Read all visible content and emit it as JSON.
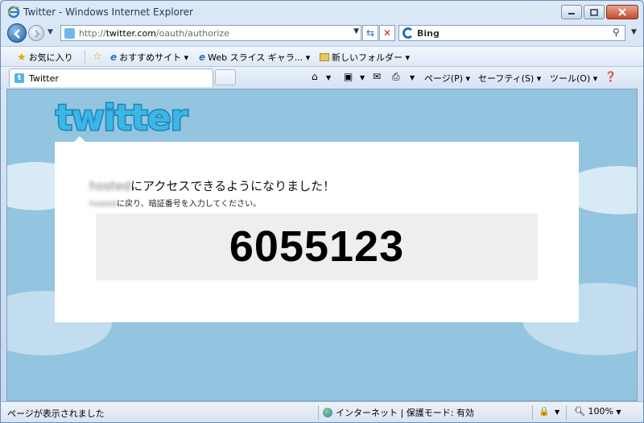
{
  "window": {
    "title": "Twitter - Windows Internet Explorer"
  },
  "address_bar": {
    "url_prefix": "http://",
    "url_host": "twitter.com",
    "url_path": "/oauth/authorize"
  },
  "search": {
    "provider": "Bing"
  },
  "favorites_bar": {
    "favorites_label": "お気に入り",
    "items": [
      "おすすめサイト ▾",
      "Web スライス ギャラ... ▾",
      "新しいフォルダー ▾"
    ]
  },
  "tabs": [
    {
      "label": "Twitter"
    }
  ],
  "command_bar": {
    "page": "ページ(P) ▾",
    "safety": "セーフティ(S) ▾",
    "tools": "ツール(O) ▾"
  },
  "page": {
    "logo_text": "twitter",
    "app_name_redacted": "hosted",
    "access_granted_suffix": "にアクセスできるようになりました！",
    "hint_app_redacted": "hosted",
    "hint_suffix": "に戻り、暗証番号を入力してください。",
    "pin": "6055123"
  },
  "status_bar": {
    "message": "ページが表示されました",
    "zone": "インターネット | 保護モード: 有効",
    "zoom": "100%"
  },
  "icons": [
    "ie-icon",
    "minimize-icon",
    "maximize-icon",
    "close-icon",
    "back-icon",
    "forward-icon",
    "refresh-icon",
    "stop-icon",
    "bing-icon",
    "search-icon",
    "favorites-star-icon",
    "home-icon",
    "feeds-icon",
    "mail-icon",
    "print-icon",
    "help-icon",
    "globe-icon",
    "zoom-icon"
  ]
}
